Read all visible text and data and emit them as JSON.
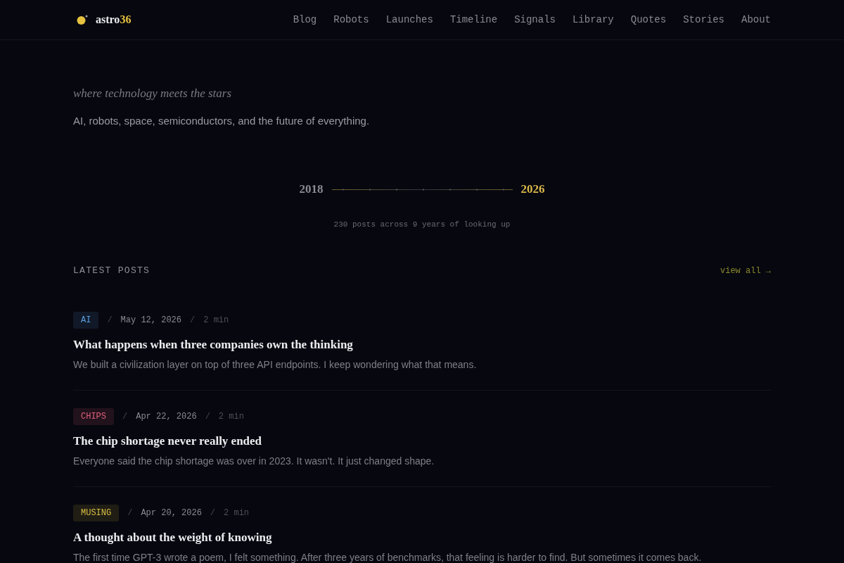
{
  "logo": {
    "name": "astro",
    "accent": "36"
  },
  "nav": [
    "Blog",
    "Robots",
    "Launches",
    "Timeline",
    "Signals",
    "Library",
    "Quotes",
    "Stories",
    "About"
  ],
  "hero": {
    "tagline": "where technology meets the stars",
    "description": "AI, robots, space, semiconductors, and the future of everything."
  },
  "timeline": {
    "start": "2018",
    "end": "2026",
    "caption": "230 posts across 9 years of looking up"
  },
  "latest_posts": {
    "heading": "LATEST POSTS",
    "view_all": "view all →",
    "posts": [
      {
        "tag": "AI",
        "color": "#5b9fe0",
        "meta": [
          {
            "kind": "separator",
            "text": "/"
          },
          {
            "kind": "date",
            "text": "May 12, 2026"
          },
          {
            "kind": "separator",
            "text": "/"
          },
          {
            "kind": "read_time",
            "text": "2 min"
          }
        ],
        "title": "What happens when three companies own the thinking",
        "excerpt": "We built a civilization layer on top of three API endpoints. I keep wondering what that means."
      },
      {
        "tag": "CHIPS",
        "color": "#e0607a",
        "meta": [
          {
            "kind": "separator",
            "text": "/"
          },
          {
            "kind": "date",
            "text": "Apr 22, 2026"
          },
          {
            "kind": "separator",
            "text": "/"
          },
          {
            "kind": "read_time",
            "text": "2 min"
          }
        ],
        "title": "The chip shortage never really ended",
        "excerpt": "Everyone said the chip shortage was over in 2023. It wasn't. It just changed shape."
      },
      {
        "tag": "MUSING",
        "color": "#d8bf42",
        "meta": [
          {
            "kind": "separator",
            "text": "/"
          },
          {
            "kind": "date",
            "text": "Apr 20, 2026"
          },
          {
            "kind": "separator",
            "text": "/"
          },
          {
            "kind": "read_time",
            "text": "2 min"
          }
        ],
        "title": "A thought about the weight of knowing",
        "excerpt": "The first time GPT-3 wrote a poem, I felt something. After three years of benchmarks, that feeling is harder to find. But sometimes it comes back."
      }
    ]
  }
}
